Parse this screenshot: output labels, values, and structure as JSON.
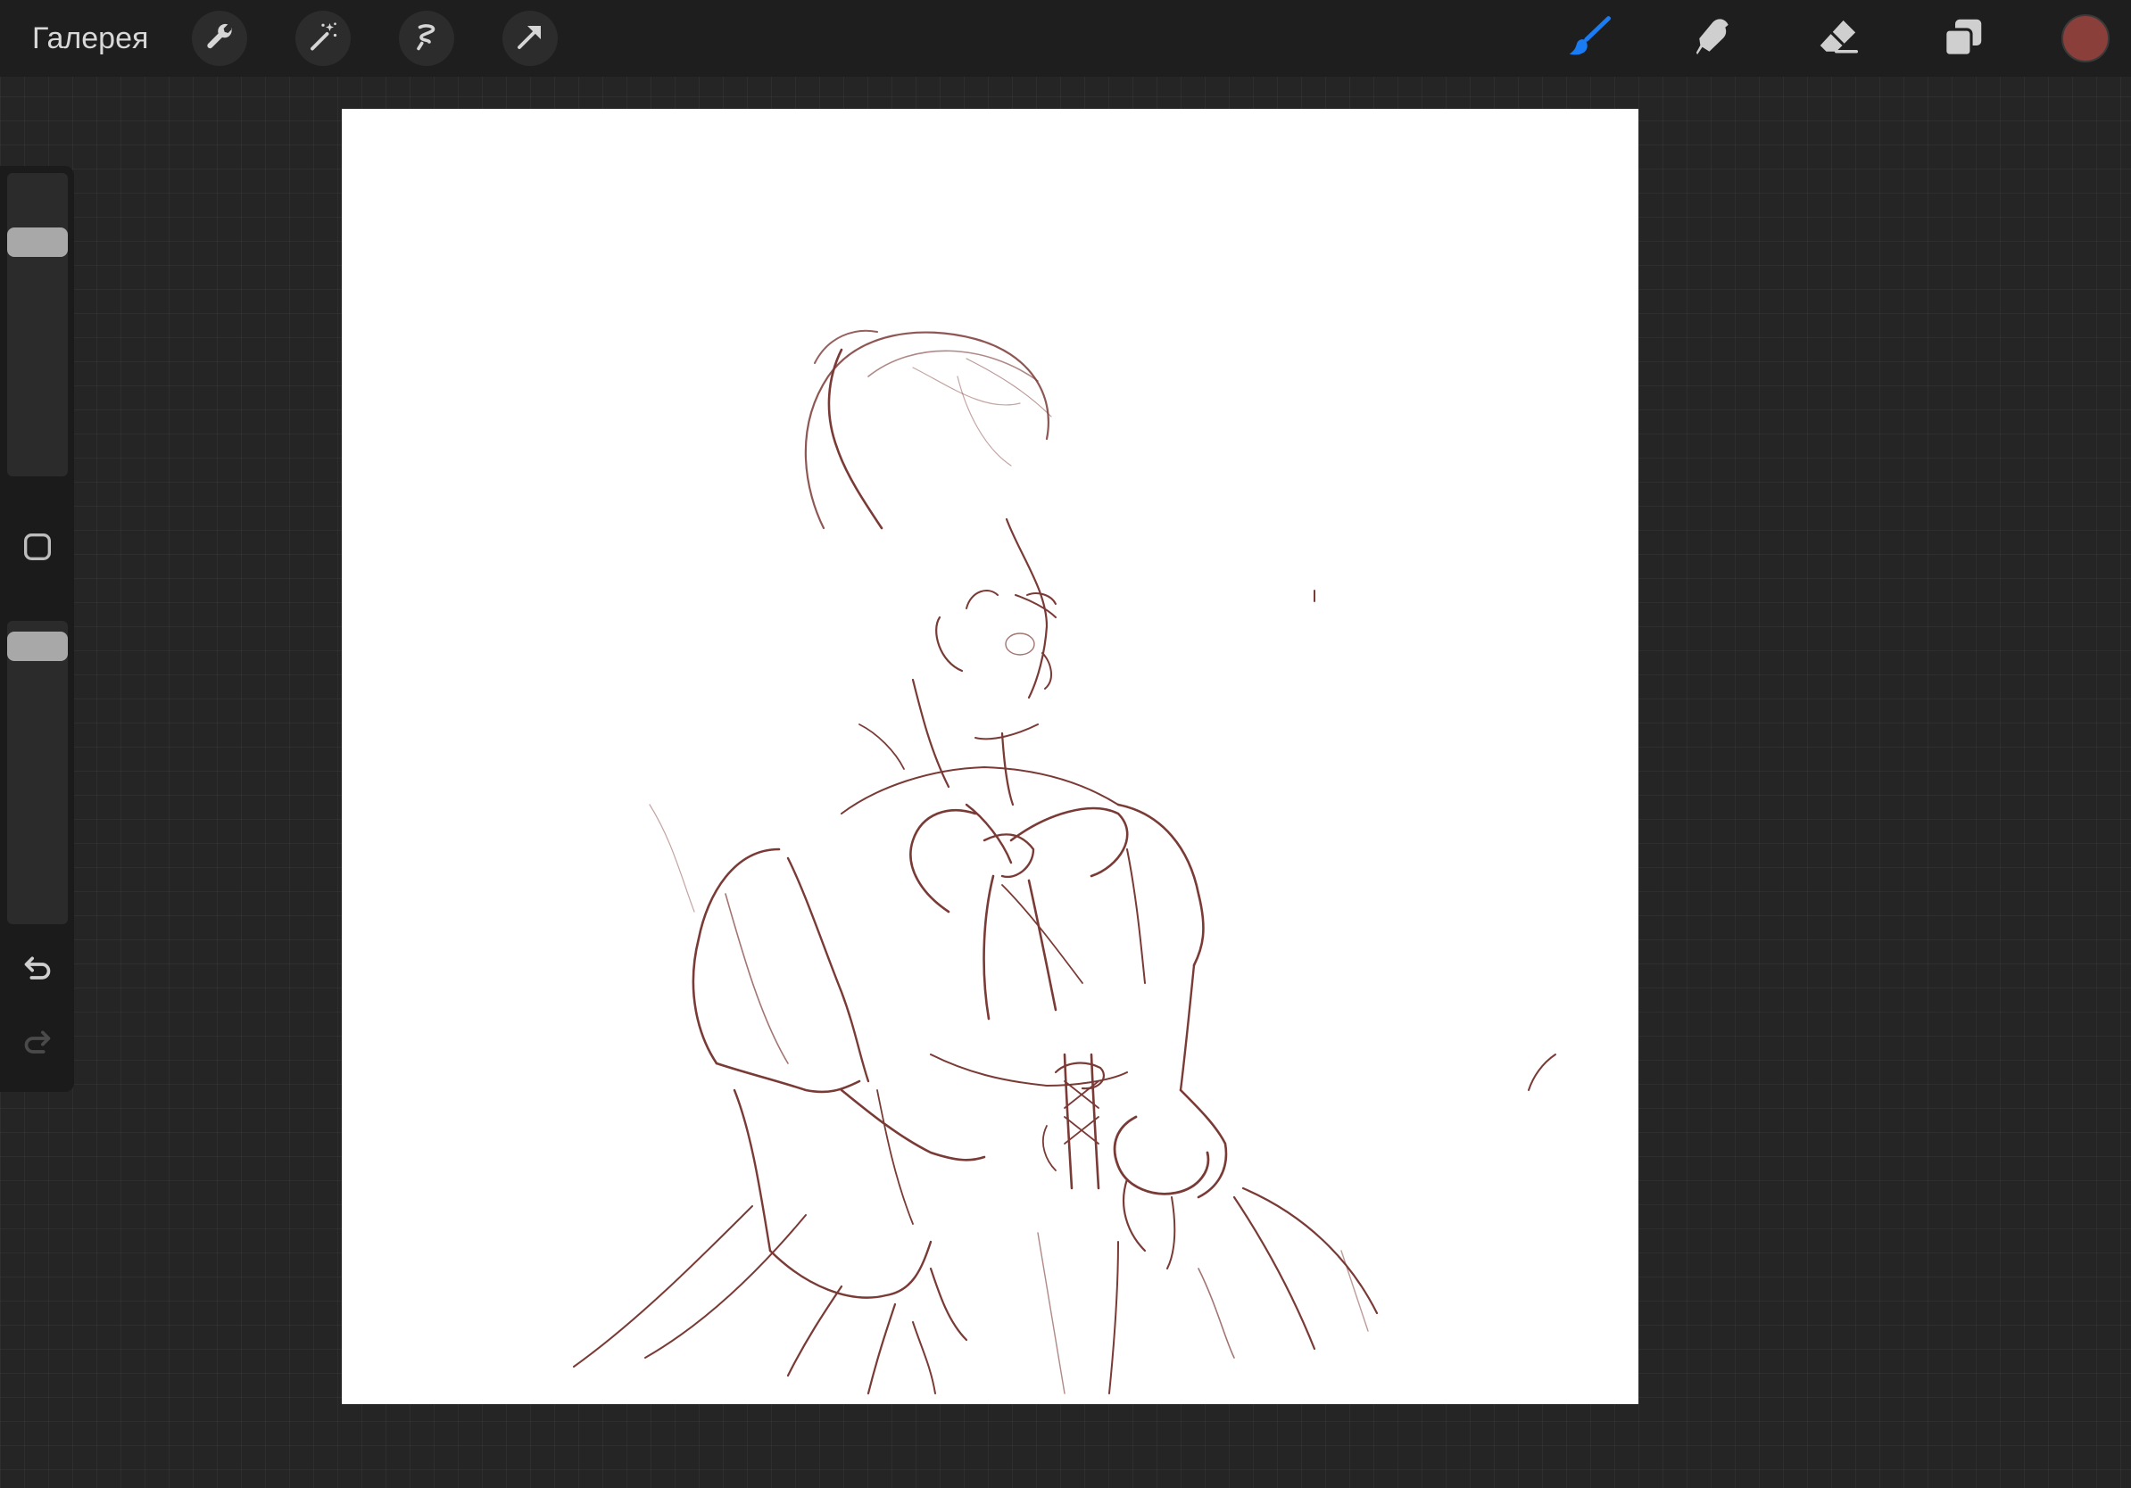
{
  "topbar": {
    "gallery_label": "Галерея",
    "left_tools": [
      "wrench-icon",
      "magic-wand-icon",
      "selection-icon",
      "transform-arrow-icon"
    ],
    "right_tools": [
      "brush-icon",
      "smudge-icon",
      "eraser-icon",
      "layers-icon"
    ],
    "active_tool": "brush-icon",
    "active_tool_color": "#1a7cf5",
    "current_color": "#8a3f3b"
  },
  "sidebar": {
    "brush_size_level": 0.2,
    "opacity_level": 0.04,
    "buttons": [
      "modify-square-icon",
      "undo-icon",
      "redo-icon"
    ]
  },
  "canvas": {
    "background": "#ffffff",
    "stroke_color": "#7a3a36"
  }
}
